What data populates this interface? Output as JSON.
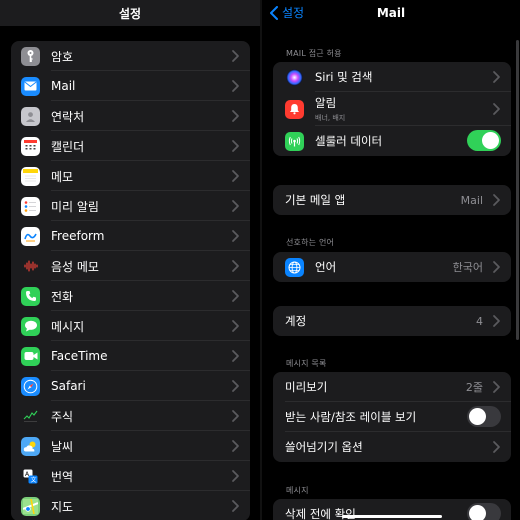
{
  "left": {
    "title": "설정",
    "items": [
      {
        "label": "암호",
        "icon": "key-icon",
        "color": "#8e8e93"
      },
      {
        "label": "Mail",
        "icon": "mail-icon",
        "color": "#1a8cff"
      },
      {
        "label": "연락처",
        "icon": "contacts-icon",
        "color": "#c7c7cc"
      },
      {
        "label": "캘린더",
        "icon": "calendar-icon",
        "color": "#ffffff"
      },
      {
        "label": "메모",
        "icon": "notes-icon",
        "color": "#ffffff"
      },
      {
        "label": "미리 알림",
        "icon": "reminders-icon",
        "color": "#ffffff"
      },
      {
        "label": "Freeform",
        "icon": "freeform-icon",
        "color": "#ffffff"
      },
      {
        "label": "음성 메모",
        "icon": "voice-memos-icon",
        "color": "#1c1c1e"
      },
      {
        "label": "전화",
        "icon": "phone-icon",
        "color": "#30d158"
      },
      {
        "label": "메시지",
        "icon": "messages-icon",
        "color": "#30d158"
      },
      {
        "label": "FaceTime",
        "icon": "facetime-icon",
        "color": "#30d158"
      },
      {
        "label": "Safari",
        "icon": "safari-icon",
        "color": "#1a8cff"
      },
      {
        "label": "주식",
        "icon": "stocks-icon",
        "color": "#1c1c1e"
      },
      {
        "label": "날씨",
        "icon": "weather-icon",
        "color": "#4ea8f5"
      },
      {
        "label": "번역",
        "icon": "translate-icon",
        "color": "#1c1c1e"
      },
      {
        "label": "지도",
        "icon": "maps-icon",
        "color": "#7ccf7a"
      }
    ]
  },
  "right": {
    "back_label": "설정",
    "title": "Mail",
    "section_access": "MAIL 접근 허용",
    "siri_label": "Siri 및 검색",
    "notifications_label": "알림",
    "notifications_sub": "배너, 배지",
    "cellular_label": "셀룰러 데이터",
    "default_app_label": "기본 메일 앱",
    "default_app_value": "Mail",
    "section_language": "선호하는 언어",
    "language_label": "언어",
    "language_value": "한국어",
    "accounts_label": "계정",
    "accounts_value": "4",
    "section_message_list": "메시지 목록",
    "preview_label": "미리보기",
    "preview_value": "2줄",
    "show_to_cc_label": "받는 사람/참조 레이블 보기",
    "swipe_options_label": "쓸어넘기기 옵션",
    "section_messages": "메시지",
    "ask_before_delete_label": "삭제 전에 확인"
  },
  "colors": {
    "accent": "#0a84ff",
    "toggle_on": "#30d158",
    "toggle_off": "#39393d",
    "cell_bg": "#1c1c1e"
  }
}
